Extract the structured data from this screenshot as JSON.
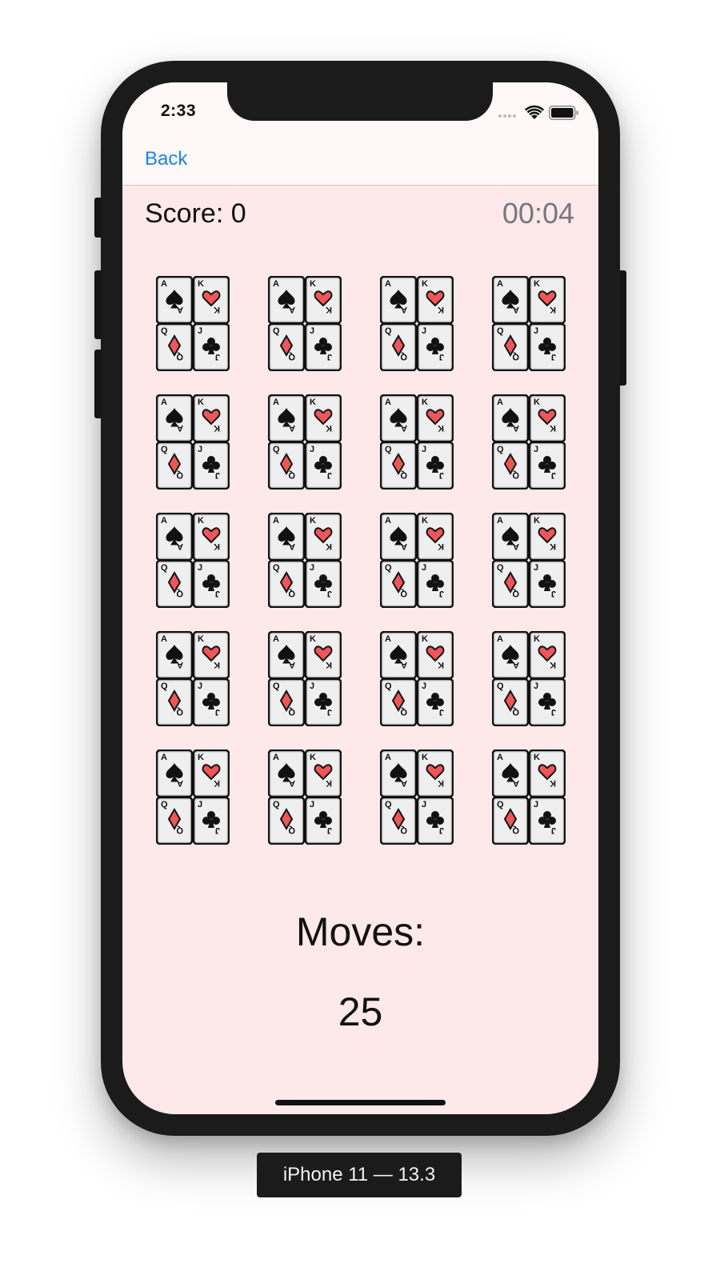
{
  "status_bar": {
    "time": "2:33",
    "icons": [
      "cellular-signal-icon",
      "wifi-icon",
      "battery-icon"
    ]
  },
  "nav": {
    "back_label": "Back"
  },
  "game": {
    "score_text": "Score: 0",
    "timer_text": "00:04",
    "cards": {
      "rows": 5,
      "columns": 4,
      "count": 20,
      "face": "playing-cards-icon",
      "ranks_shown": [
        "A",
        "K",
        "Q",
        "J"
      ]
    },
    "moves_label": "Moves:",
    "moves_value": "25"
  },
  "device_label": "iPhone 11 — 13.3",
  "colors": {
    "screen_background": "#fde8ea",
    "nav_background": "#fef8f8",
    "link_blue": "#1a84ec",
    "timer_gray": "#75787f",
    "card_red": "#f0555a",
    "card_body": "#dcdcdc"
  }
}
